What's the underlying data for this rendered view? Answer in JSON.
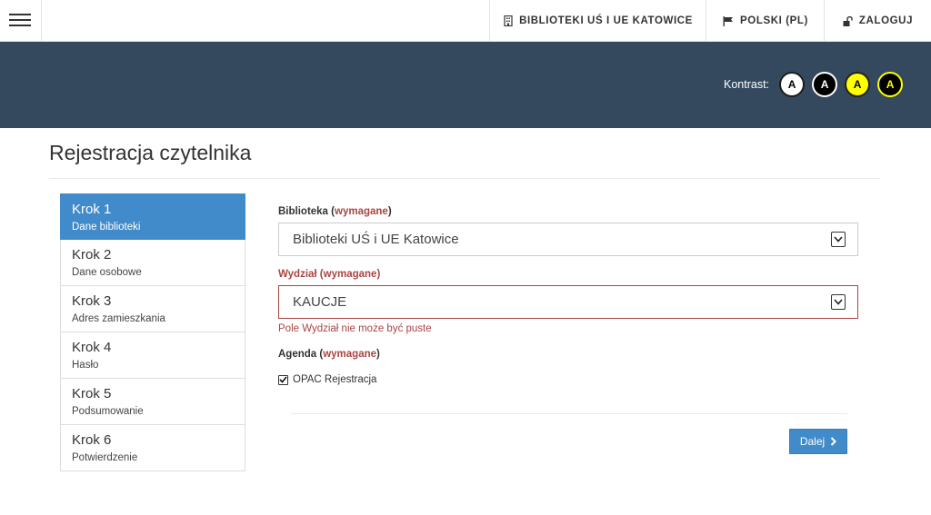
{
  "topnav": {
    "menu_icon": "hamburger-menu-icon",
    "libraries": {
      "label": "BIBLIOTEKI UŚ I UE KATOWICE",
      "icon": "building-icon"
    },
    "language": {
      "label": "POLSKI (PL)",
      "icon": "flag-icon"
    },
    "login": {
      "label": "ZALOGUJ",
      "icon": "unlock-icon"
    }
  },
  "header": {
    "background_color": "#34495e",
    "contrast_label": "Kontrast:",
    "contrast_options": [
      {
        "label": "A",
        "bg": "#ffffff",
        "fg": "#000000"
      },
      {
        "label": "A",
        "bg": "#000000",
        "fg": "#ffffff"
      },
      {
        "label": "A",
        "bg": "#ffff00",
        "fg": "#000000"
      },
      {
        "label": "A",
        "bg": "#000000",
        "fg": "#ffff00"
      }
    ]
  },
  "page": {
    "title": "Rejestracja czytelnika"
  },
  "steps": [
    {
      "title": "Krok 1",
      "subtitle": "Dane biblioteki",
      "active": true
    },
    {
      "title": "Krok 2",
      "subtitle": "Dane osobowe",
      "active": false
    },
    {
      "title": "Krok 3",
      "subtitle": "Adres zamieszkania",
      "active": false
    },
    {
      "title": "Krok 4",
      "subtitle": "Hasło",
      "active": false
    },
    {
      "title": "Krok 5",
      "subtitle": "Podsumowanie",
      "active": false
    },
    {
      "title": "Krok 6",
      "subtitle": "Potwierdzenie",
      "active": false
    }
  ],
  "form": {
    "library": {
      "label": "Biblioteka",
      "required": "wymagane",
      "value": "Biblioteki UŚ i UE Katowice"
    },
    "department": {
      "label": "Wydział",
      "required": "wymagane",
      "value": "KAUCJE",
      "error": "Pole Wydział nie może być puste"
    },
    "agenda": {
      "label": "Agenda",
      "required": "wymagane",
      "option": "OPAC Rejestracja",
      "checked": true
    },
    "next_button": "Dalej"
  },
  "colors": {
    "accent": "#428bca",
    "error": "#a94442"
  }
}
